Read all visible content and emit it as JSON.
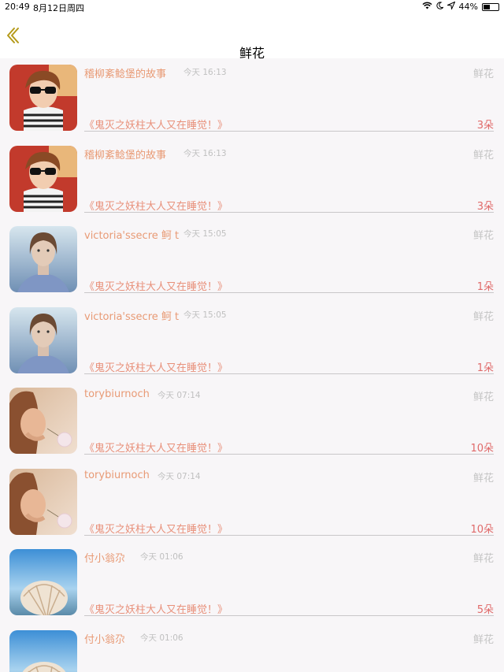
{
  "status_bar": {
    "time": "20:49",
    "date": "8月12日周四",
    "battery": "44%",
    "battery_level": 0.44,
    "icons": [
      "wifi-icon",
      "moon-icon",
      "location-arrow-icon",
      "battery-icon"
    ]
  },
  "nav": {
    "title": "鲜花",
    "back_icon": "chevron-left-icon",
    "back_color": "#b59a1a"
  },
  "colors": {
    "username": "#e89a75",
    "book_title": "#e8907a",
    "count": "#e06a6a",
    "muted": "#c0c0c0"
  },
  "rows": [
    {
      "username": "稽柳紊鲶堡的故事",
      "time": "今天 16:13",
      "gift": "鲜花",
      "book": "《鬼灭之妖柱大人又在睡觉！》",
      "count": "3朵",
      "avatar": "boy-sunglasses"
    },
    {
      "username": "稽柳紊鲶堡的故事",
      "time": "今天 16:13",
      "gift": "鲜花",
      "book": "《鬼灭之妖柱大人又在睡觉！》",
      "count": "3朵",
      "avatar": "boy-sunglasses"
    },
    {
      "username": "victoria'ssecre 鲄 t",
      "time": "今天 15:05",
      "gift": "鲜花",
      "book": "《鬼灭之妖柱大人又在睡觉！》",
      "count": "1朵",
      "avatar": "woman-portrait"
    },
    {
      "username": "victoria'ssecre 鲄 t",
      "time": "今天 15:05",
      "gift": "鲜花",
      "book": "《鬼灭之妖柱大人又在睡觉！》",
      "count": "1朵",
      "avatar": "woman-portrait"
    },
    {
      "username": "torybiurnoch",
      "time": "今天 07:14",
      "gift": "鲜花",
      "book": "《鬼灭之妖柱大人又在睡觉！》",
      "count": "10朵",
      "avatar": "girl-dandelion"
    },
    {
      "username": "torybiurnoch",
      "time": "今天 07:14",
      "gift": "鲜花",
      "book": "《鬼灭之妖柱大人又在睡觉！》",
      "count": "10朵",
      "avatar": "girl-dandelion"
    },
    {
      "username": "付小翁尕",
      "time": "今天 01:06",
      "gift": "鲜花",
      "book": "《鬼灭之妖柱大人又在睡觉！》",
      "count": "5朵",
      "avatar": "seashell-beach"
    },
    {
      "username": "付小翁尕",
      "time": "今天 01:06",
      "gift": "鲜花",
      "book": "",
      "count": "",
      "avatar": "seashell-beach"
    }
  ]
}
